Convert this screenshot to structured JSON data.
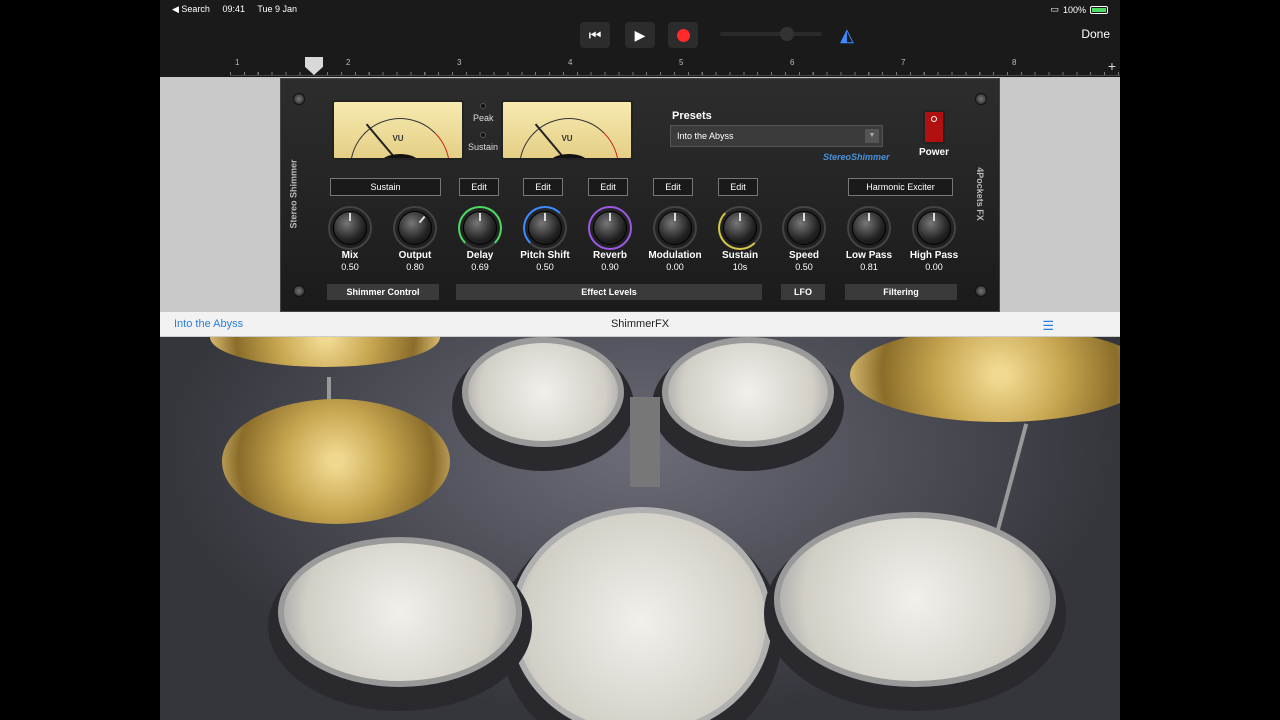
{
  "status_bar": {
    "back": "◀ Search",
    "time": "09:41",
    "date": "Tue 9 Jan",
    "battery": "100%",
    "battery_level": 1.0
  },
  "transport": {
    "done_label": "Done",
    "volume_level": 0.62
  },
  "ruler": {
    "bars": [
      "1",
      "2",
      "3",
      "4",
      "5",
      "6",
      "7",
      "8"
    ]
  },
  "plugin": {
    "side_left": "Stereo Shimmer",
    "side_right": "4Pockets FX",
    "vu_label": "VU",
    "peak_label": "Peak",
    "sustain_led_label": "Sustain",
    "presets_label": "Presets",
    "preset_value": "Into the Abyss",
    "brand": "StereoShimmer",
    "power_label": "Power",
    "buttons": {
      "sustain": "Sustain",
      "edit": "Edit",
      "harmonic": "Harmonic Exciter"
    },
    "knobs": [
      {
        "name": "Mix",
        "value": "0.50"
      },
      {
        "name": "Output",
        "value": "0.80"
      },
      {
        "name": "Delay",
        "value": "0.69"
      },
      {
        "name": "Pitch Shift",
        "value": "0.50"
      },
      {
        "name": "Reverb",
        "value": "0.90"
      },
      {
        "name": "Modulation",
        "value": "0.00"
      },
      {
        "name": "Sustain",
        "value": "10s"
      },
      {
        "name": "Speed",
        "value": "0.50"
      },
      {
        "name": "Low Pass",
        "value": "0.81"
      },
      {
        "name": "High Pass",
        "value": "0.00"
      }
    ],
    "sections": [
      "Shimmer Control",
      "Effect Levels",
      "LFO",
      "Filtering"
    ]
  },
  "titlebar": {
    "preset": "Into the Abyss",
    "title": "ShimmerFX"
  },
  "colors": {
    "accent": "#2a7de1",
    "record": "#ff2a2a",
    "power": "#b01010",
    "delay_ring": "#4cd964",
    "pitch_ring": "#3d8bff",
    "reverb_ring": "#9b59e6",
    "sustain_ring": "#d4c74a"
  }
}
